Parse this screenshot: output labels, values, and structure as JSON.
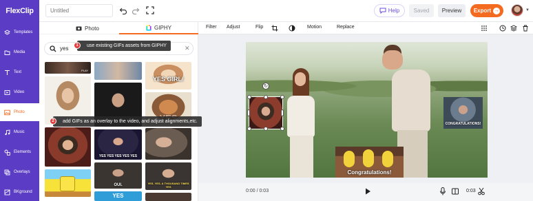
{
  "app": {
    "logo_text": "FlexClip",
    "title_placeholder": "Untitled"
  },
  "topbar": {
    "help_label": "Help",
    "saved_label": "Saved",
    "preview_label": "Preview",
    "export_label": "Export",
    "accent_color": "#f46a1f",
    "brand_color": "#5b3cc4"
  },
  "nav": {
    "items": [
      {
        "label": "Templates",
        "icon": "layers-icon"
      },
      {
        "label": "Media",
        "icon": "folder-icon"
      },
      {
        "label": "Text",
        "icon": "text-icon"
      },
      {
        "label": "Video",
        "icon": "video-icon"
      },
      {
        "label": "Photo",
        "icon": "image-icon"
      },
      {
        "label": "Music",
        "icon": "music-icon"
      },
      {
        "label": "Elements",
        "icon": "shapes-icon"
      },
      {
        "label": "Overlays",
        "icon": "overlay-icon"
      },
      {
        "label": "BKground",
        "icon": "background-icon"
      }
    ],
    "active": "Photo"
  },
  "panel": {
    "tabs": [
      {
        "label": "Photo"
      },
      {
        "label": "GIPHY"
      }
    ],
    "active_tab": "GIPHY",
    "search_value": "yes",
    "gif_captions": [
      "YES GIRL!",
      "YES",
      "CONGRATULATIONS!",
      "YES YES YES YES YES",
      "OUI.",
      "YES. YES. A THOUSAND TIMES YES",
      "YES",
      "PLAY"
    ]
  },
  "edit_toolbar": {
    "filter_label": "Filter",
    "adjust_label": "Adjust",
    "flip_label": "Flip",
    "motion_label": "Motion",
    "replace_label": "Replace"
  },
  "canvas": {
    "overlay_captions": [
      "CONGRATULATIONS!",
      "Congratulations!"
    ]
  },
  "playback": {
    "current_time": "0:00",
    "total_time": "0:03",
    "time_display": "0:00 / 0:03",
    "clip_duration": "0:03"
  },
  "callouts": {
    "step1": {
      "number": "1",
      "text": "use existing GIFs assets from GIPHY"
    },
    "step2": {
      "number": "2",
      "text": "add GIFs as an overlay to the video, and adjust alignments,etc."
    }
  }
}
